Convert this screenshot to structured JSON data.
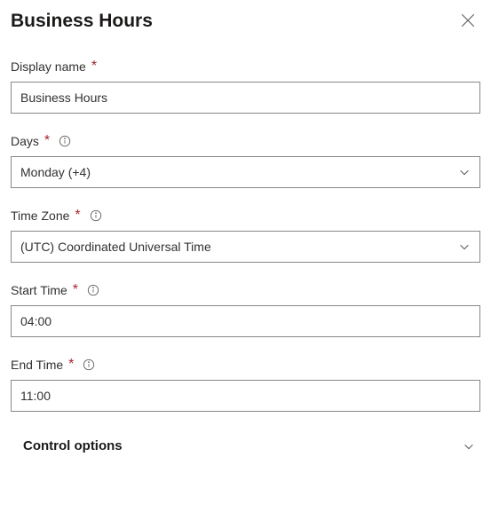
{
  "header": {
    "title": "Business Hours"
  },
  "fields": {
    "display_name": {
      "label": "Display name",
      "value": "Business Hours"
    },
    "days": {
      "label": "Days",
      "value": "Monday (+4)"
    },
    "time_zone": {
      "label": "Time Zone",
      "value": "(UTC) Coordinated Universal Time"
    },
    "start_time": {
      "label": "Start Time",
      "value": "04:00"
    },
    "end_time": {
      "label": "End Time",
      "value": "11:00"
    }
  },
  "control_options": {
    "label": "Control options"
  }
}
